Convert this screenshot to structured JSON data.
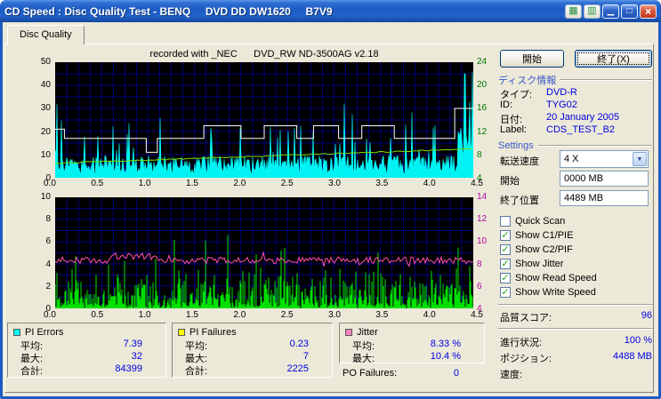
{
  "window": {
    "title": "CD Speed : Disc Quality Test - BENQ     DVD DD DW1620     B7V9"
  },
  "icons": {
    "tool1": "▦",
    "tool2": "▥",
    "minimize": "▁",
    "maximize": "□",
    "close": "×",
    "combo_arrow": "▼",
    "check": "✓"
  },
  "tabs": {
    "disc_quality": "Disc Quality"
  },
  "recorded_note": "recorded with _NEC      DVD_RW ND-3500AG v2.18",
  "actions": {
    "start": "開始",
    "exit": "終了(X)"
  },
  "disc_info": {
    "heading": "ディスク情報",
    "rows": [
      {
        "label": "タイプ:",
        "value": "DVD-R"
      },
      {
        "label": "ID:",
        "value": "TYG02"
      },
      {
        "label": "日付:",
        "value": "20 January 2005"
      },
      {
        "label": "Label:",
        "value": "CDS_TEST_B2"
      }
    ]
  },
  "settings": {
    "heading": "Settings",
    "transfer_speed_label": "転送速度",
    "transfer_speed_value": "4 X",
    "start_label": "開始",
    "start_value": "0000 MB",
    "end_label": "終了位置",
    "end_value": "4489 MB",
    "checkboxes": [
      {
        "label": "Quick Scan",
        "checked": false
      },
      {
        "label": "Show C1/PIE",
        "checked": true
      },
      {
        "label": "Show C2/PIF",
        "checked": true
      },
      {
        "label": "Show Jitter",
        "checked": true
      },
      {
        "label": "Show Read Speed",
        "checked": true
      },
      {
        "label": "Show Write Speed",
        "checked": true
      }
    ]
  },
  "score": {
    "label": "品質スコア:",
    "value": "96"
  },
  "status": [
    {
      "label": "進行状況:",
      "value": "100 %"
    },
    {
      "label": "ポジション:",
      "value": "4488 MB"
    },
    {
      "label": "速度:",
      "value": ""
    }
  ],
  "summary": {
    "pi_errors": {
      "name": "PI Errors",
      "color": "#00FFFF",
      "rows": [
        {
          "label": "平均:",
          "value": "7.39"
        },
        {
          "label": "最大:",
          "value": "32"
        },
        {
          "label": "合計:",
          "value": "84399"
        }
      ]
    },
    "pi_failures": {
      "name": "PI Failures",
      "color": "#FFFF00",
      "rows": [
        {
          "label": "平均:",
          "value": "0.23"
        },
        {
          "label": "最大:",
          "value": "7"
        },
        {
          "label": "合計:",
          "value": "2225"
        }
      ]
    },
    "jitter": {
      "name": "Jitter",
      "color": "#FF80C0",
      "rows": [
        {
          "label": "平均:",
          "value": "8.33 %"
        },
        {
          "label": "最大:",
          "value": "10.4 %"
        }
      ]
    },
    "po_failures": {
      "label": "PO Failures:",
      "value": "0"
    }
  },
  "chart_data": [
    {
      "type": "area",
      "title": "PI Errors scan",
      "xlim": [
        0,
        4.5
      ],
      "ylim": [
        0,
        50
      ],
      "x_ticks": [
        "0.0",
        "0.5",
        "1.0",
        "1.5",
        "2.0",
        "2.5",
        "3.0",
        "3.5",
        "4.0",
        "4.5"
      ],
      "y_left_ticks": [
        "50",
        "40",
        "30",
        "20",
        "10",
        "0"
      ],
      "y_right_ticks": [
        "24",
        "20",
        "16",
        "12",
        "8",
        "4"
      ],
      "grid": {
        "color": "#0000A8",
        "x_step_gb": 0.125,
        "y_step": 5
      },
      "series": [
        {
          "name": "PI Errors",
          "color": "#00FFFF",
          "style": "spiky-area",
          "seed": 7,
          "avg": 7.39,
          "max": 32,
          "total": 84399
        },
        {
          "name": "Read Speed",
          "color": "#FFFFFF",
          "style": "step",
          "segments": [
            [
              0,
              0.1,
              21
            ],
            [
              0.1,
              0.98,
              17
            ],
            [
              0.98,
              1.1,
              11
            ],
            [
              1.1,
              1.6,
              17
            ],
            [
              1.6,
              2.0,
              22.5
            ],
            [
              2.0,
              2.25,
              17
            ],
            [
              2.25,
              2.6,
              22.5
            ],
            [
              2.6,
              2.78,
              17
            ],
            [
              2.78,
              3.05,
              22.5
            ],
            [
              3.05,
              3.3,
              17
            ],
            [
              3.3,
              3.65,
              22.5
            ],
            [
              3.65,
              4.3,
              17
            ],
            [
              4.3,
              4.5,
              30
            ]
          ]
        },
        {
          "name": "Write Speed",
          "color": "#7FE000",
          "style": "rising-line",
          "from": 6.3,
          "to": 12.5,
          "seed": 3
        }
      ]
    },
    {
      "type": "line",
      "title": "PI Failures / Jitter scan",
      "xlim": [
        0,
        4.5
      ],
      "ylim": [
        0,
        10
      ],
      "x_ticks": [
        "0.0",
        "0.5",
        "1.0",
        "1.5",
        "2.0",
        "2.5",
        "3.0",
        "3.5",
        "4.0",
        "4.5"
      ],
      "y_left_ticks": [
        "10",
        "8",
        "6",
        "4",
        "2",
        "0"
      ],
      "y_right_ticks": [
        "14",
        "12",
        "10",
        "8",
        "6",
        "4"
      ],
      "grid": {
        "color": "#0000A8",
        "x_step_gb": 0.125,
        "y_step": 1
      },
      "series": [
        {
          "name": "PI Failures",
          "color": "#00E000",
          "style": "spikes",
          "seed": 11,
          "avg": 0.23,
          "max": 7,
          "total": 2225
        },
        {
          "name": "Jitter",
          "color": "#FF50B0",
          "style": "noisy-line",
          "base": 4.33,
          "seed": 5,
          "avg_percent": 8.33,
          "max_percent": 10.4
        }
      ]
    }
  ]
}
